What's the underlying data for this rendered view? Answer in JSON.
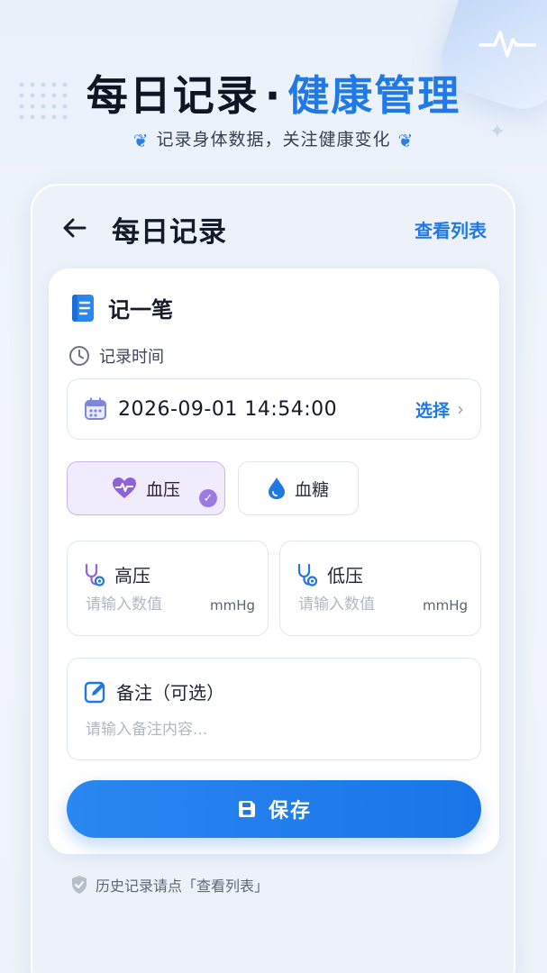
{
  "banner": {
    "title_part1": "每日记录",
    "separator": "·",
    "title_part2": "健康管理",
    "subtitle": "记录身体数据，关注健康变化"
  },
  "topbar": {
    "title": "每日记录",
    "view_list": "查看列表"
  },
  "form": {
    "section_title": "记一笔",
    "time_label": "记录时间",
    "time_value": "2026-09-01 14:54:00",
    "time_select": "选择",
    "tabs": [
      {
        "label": "血压",
        "active": true
      },
      {
        "label": "血糖",
        "active": false
      }
    ],
    "systolic": {
      "label": "高压",
      "placeholder": "请输入数值",
      "unit": "mmHg"
    },
    "diastolic": {
      "label": "低压",
      "placeholder": "请输入数值",
      "unit": "mmHg"
    },
    "remark": {
      "label": "备注（可选）",
      "placeholder": "请输入备注内容..."
    },
    "save_label": "保存"
  },
  "hint": "历史记录请点「查看列表」",
  "colors": {
    "accent": "#1f78e4",
    "active_tab_bg": "#f1ecfd",
    "check_purple": "#9a7be4"
  }
}
